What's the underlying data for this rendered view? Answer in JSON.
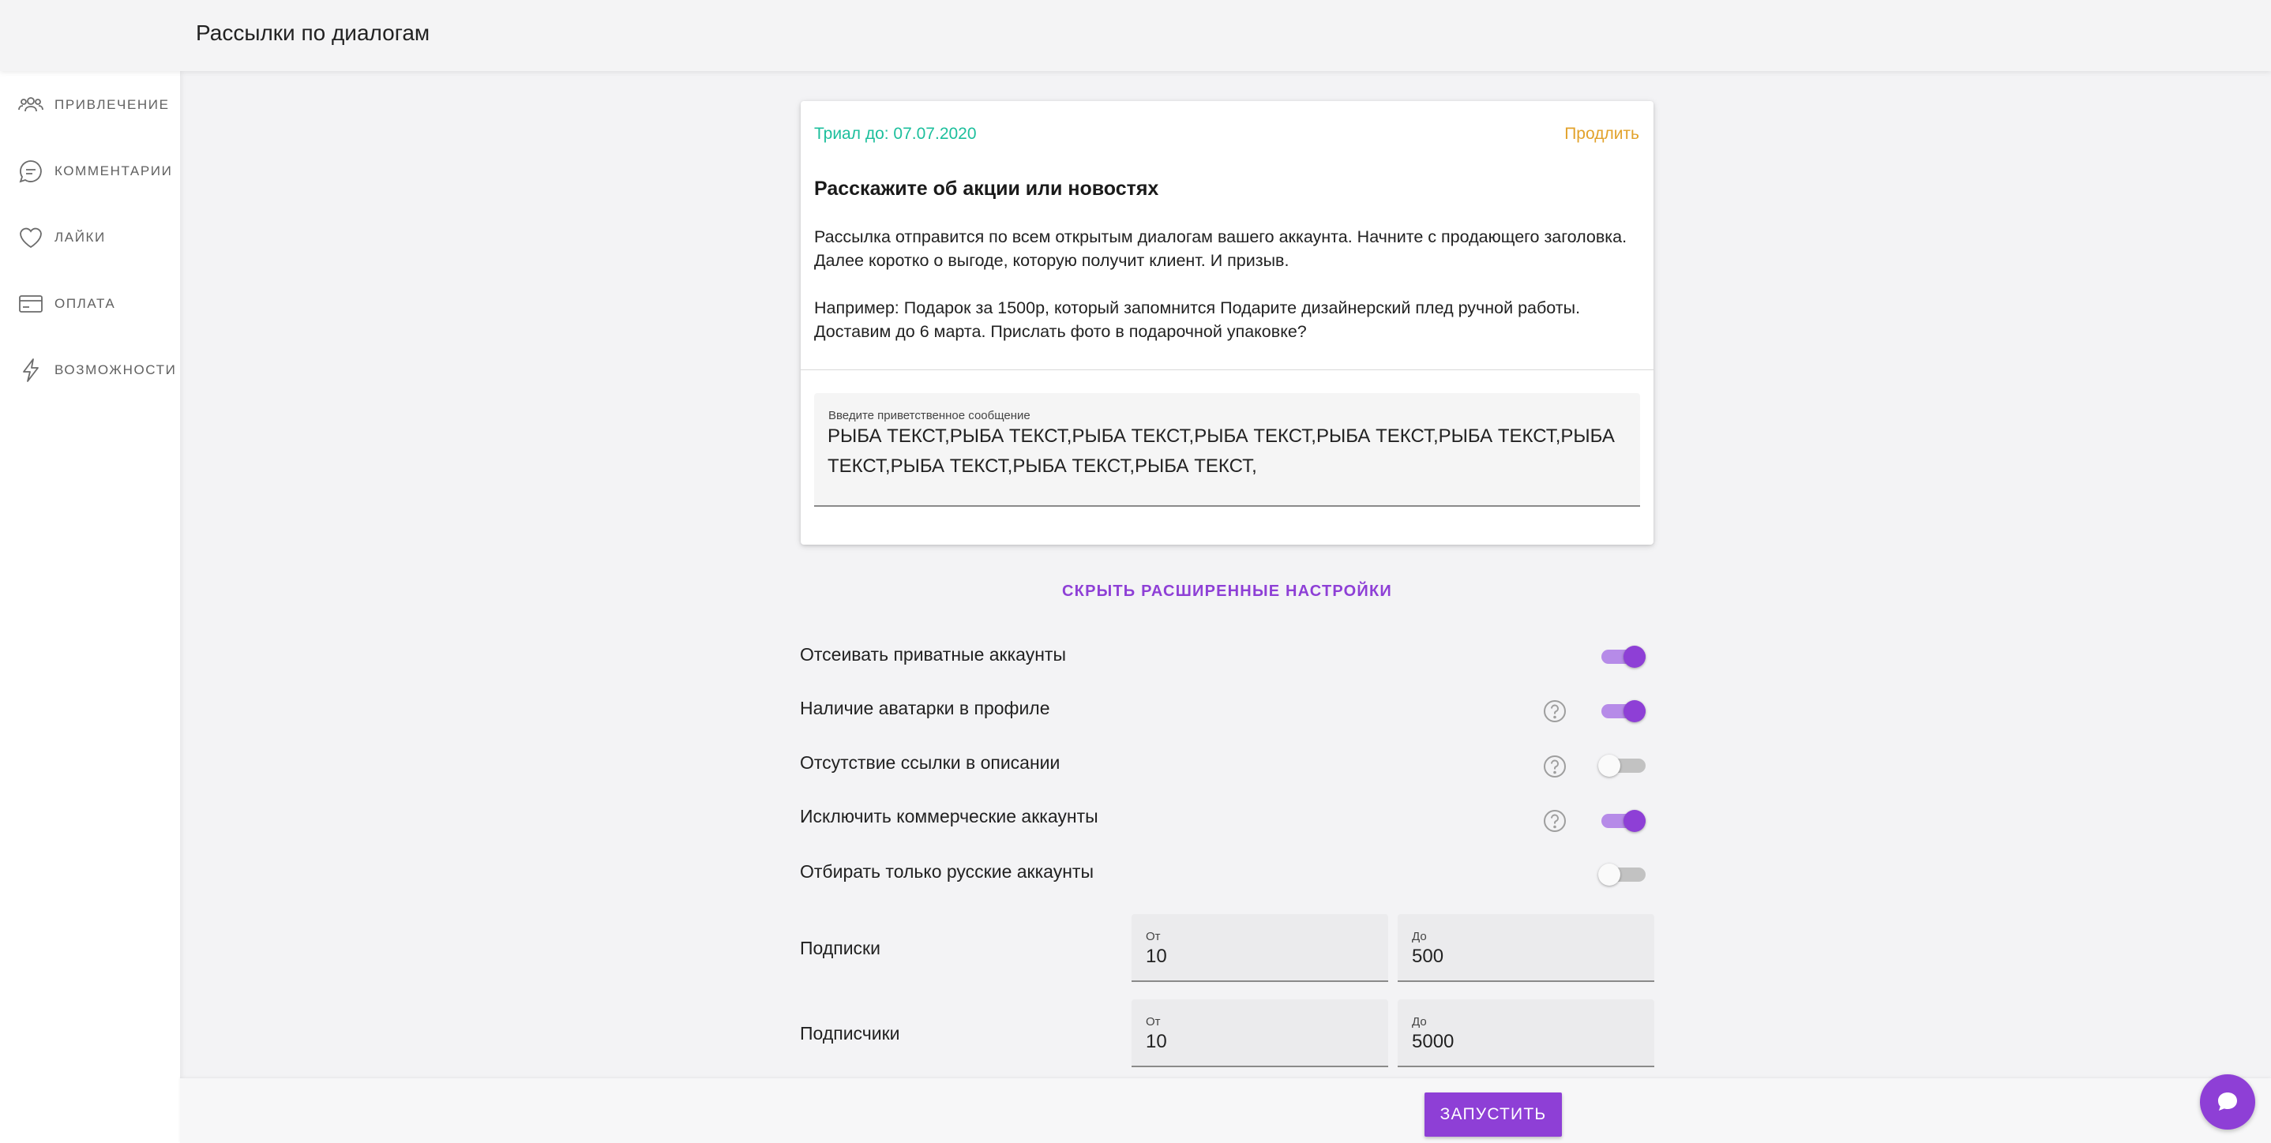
{
  "header": {
    "title": "Рассылки по диалогам"
  },
  "sidebar": {
    "items": [
      {
        "label": "ПРИВЛЕЧЕНИЕ",
        "icon": "people-icon"
      },
      {
        "label": "КОММЕНТАРИИ",
        "icon": "comment-icon"
      },
      {
        "label": "ЛАЙКИ",
        "icon": "heart-icon"
      },
      {
        "label": "ОПЛАТА",
        "icon": "credit-card-icon"
      },
      {
        "label": "ВОЗМОЖНОСТИ",
        "icon": "lightning-icon"
      }
    ]
  },
  "card": {
    "trial": "Триал до: 07.07.2020",
    "extend": "Продлить",
    "heading": "Расскажите об акции или новостях",
    "paragraph1": "Рассылка отправится по всем открытым диалогам вашего аккаунта. Начните с продающего заголовка. Далее коротко о выгоде, которую получит клиент. И призыв.",
    "paragraph2": "Например: Подарок за 1500р, который запомнится Подарите дизайнерский плед ручной работы. Доставим до 6 марта. Прислать фото в подарочной упаковке?",
    "message_label": "Введите приветственное сообщение",
    "message_value": "РЫБА ТЕКСТ,РЫБА ТЕКСТ,РЫБА ТЕКСТ,РЫБА ТЕКСТ,РЫБА ТЕКСТ,РЫБА ТЕКСТ,РЫБА ТЕКСТ,РЫБА ТЕКСТ,РЫБА ТЕКСТ,РЫБА ТЕКСТ,"
  },
  "advanced_link": "СКРЫТЬ РАСШИРЕННЫЕ НАСТРОЙКИ",
  "options": [
    {
      "label": "Отсеивать приватные аккаунты",
      "enabled": true,
      "help": false
    },
    {
      "label": "Наличие аватарки в профиле",
      "enabled": true,
      "help": true
    },
    {
      "label": "Отсутствие ссылки в описании",
      "enabled": false,
      "help": true
    },
    {
      "label": "Исключить коммерческие аккаунты",
      "enabled": true,
      "help": true
    },
    {
      "label": "Отбирать только русские аккаунты",
      "enabled": false,
      "help": false
    }
  ],
  "ranges": {
    "subscriptions": {
      "label": "Подписки",
      "from_label": "От",
      "from": "10",
      "to_label": "До",
      "to": "500"
    },
    "subscribers": {
      "label": "Подписчики",
      "from_label": "От",
      "from": "10",
      "to_label": "До",
      "to": "5000"
    }
  },
  "run_button": "ЗАПУСТИТЬ",
  "colors": {
    "accent": "#8e3fd6",
    "trial": "#1cbf9c",
    "extend": "#e2a22b"
  }
}
